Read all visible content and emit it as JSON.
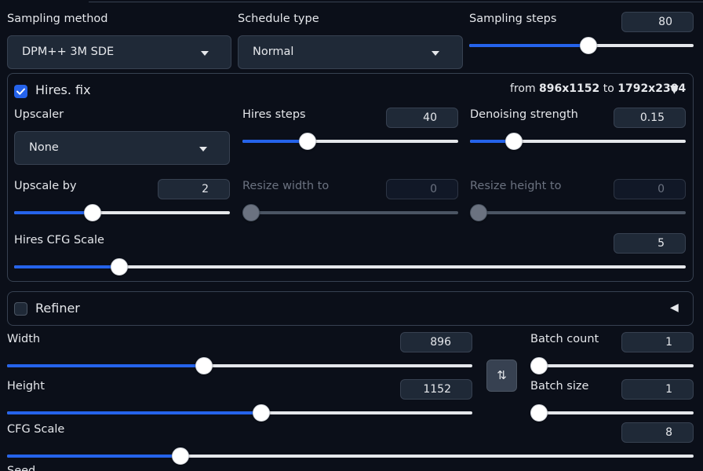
{
  "sampling_method": {
    "label": "Sampling method",
    "value": "DPM++ 3M SDE"
  },
  "schedule_type": {
    "label": "Schedule type",
    "value": "Normal"
  },
  "sampling_steps": {
    "label": "Sampling steps",
    "value": "80",
    "fraction": 0.5333
  },
  "hires_fix": {
    "title": "Hires. fix",
    "checked": true,
    "resolution": {
      "from_prefix": "from ",
      "from": "896x1152",
      "to_prefix": " to ",
      "to": "1792x2304"
    },
    "toggle_glyph": "▼",
    "upscaler": {
      "label": "Upscaler",
      "value": "None"
    },
    "hires_steps": {
      "label": "Hires steps",
      "value": "40",
      "fraction": 0.2857
    },
    "denoising_strength": {
      "label": "Denoising strength",
      "value": "0.15",
      "fraction": 0.1765
    },
    "upscale_by": {
      "label": "Upscale by",
      "value": "2",
      "fraction": 0.3506
    },
    "resize_width": {
      "label": "Resize width to",
      "value": "0",
      "fraction": 0.0,
      "disabled": true
    },
    "resize_height": {
      "label": "Resize height to",
      "value": "0",
      "fraction": 0.0,
      "disabled": true
    },
    "hires_cfg_scale": {
      "label": "Hires CFG Scale",
      "value": "5",
      "fraction": 0.1472
    }
  },
  "refiner": {
    "title": "Refiner",
    "checked": false,
    "toggle_glyph": "◀"
  },
  "width": {
    "label": "Width",
    "value": "896",
    "fraction": 0.4211
  },
  "height": {
    "label": "Height",
    "value": "1152",
    "fraction": 0.5474
  },
  "swap_button": {
    "glyph": "⇅"
  },
  "batch_count": {
    "label": "Batch count",
    "value": "1",
    "fraction": 0.0
  },
  "batch_size": {
    "label": "Batch size",
    "value": "1",
    "fraction": 0.0
  },
  "cfg_scale": {
    "label": "CFG Scale",
    "value": "8",
    "fraction": 0.2463
  },
  "seed": {
    "label": "Seed"
  },
  "colors": {
    "accent": "#2563eb",
    "background": "#0b0f19",
    "panel_border": "#374151"
  }
}
